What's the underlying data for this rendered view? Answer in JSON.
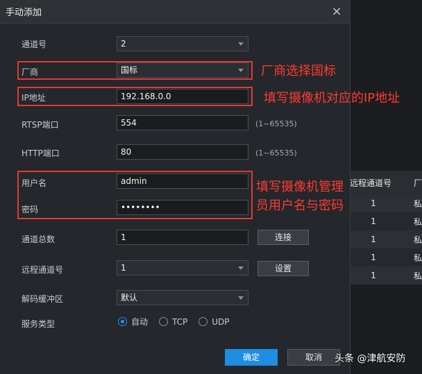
{
  "dialog": {
    "title": "手动添加",
    "close_glyph": "×",
    "fields": {
      "channel_no": {
        "label": "通道号",
        "value": "2"
      },
      "vendor": {
        "label": "厂商",
        "value": "国标"
      },
      "ip": {
        "label": "IP地址",
        "value": "192.168.0.0"
      },
      "rtsp_port": {
        "label": "RTSP端口",
        "value": "554",
        "hint": "(1~65535)"
      },
      "http_port": {
        "label": "HTTP端口",
        "value": "80",
        "hint": "(1~65535)"
      },
      "username": {
        "label": "用户名",
        "value": "admin"
      },
      "password": {
        "label": "密码",
        "value": "••••••••"
      },
      "total_channels": {
        "label": "通道总数",
        "value": "1",
        "button": "连接"
      },
      "remote_channel": {
        "label": "远程通道号",
        "value": "1",
        "button": "设置"
      },
      "decode_buffer": {
        "label": "解码缓冲区",
        "value": "默认"
      },
      "service_type": {
        "label": "服务类型",
        "options": [
          "自动",
          "TCP",
          "UDP"
        ],
        "selected": "自动"
      }
    },
    "ok_label": "确定",
    "cancel_label": "取消"
  },
  "annotations": {
    "vendor_note": "厂商选择国标",
    "ip_note": "填写摄像机对应的IP地址",
    "cred_note_line1": "填写摄像机管理",
    "cred_note_line2": "员用户名与密码",
    "color": "#e53935"
  },
  "background_table": {
    "headers": [
      "远程通道号",
      "厂"
    ],
    "rows": [
      [
        "1",
        "私"
      ],
      [
        "1",
        "私"
      ],
      [
        "1",
        "私"
      ],
      [
        "1",
        "私"
      ],
      [
        "1",
        "私"
      ]
    ]
  },
  "brand": "头条 @津航安防",
  "colors": {
    "accent": "#1e8de4",
    "annotation": "#ff3b30"
  }
}
